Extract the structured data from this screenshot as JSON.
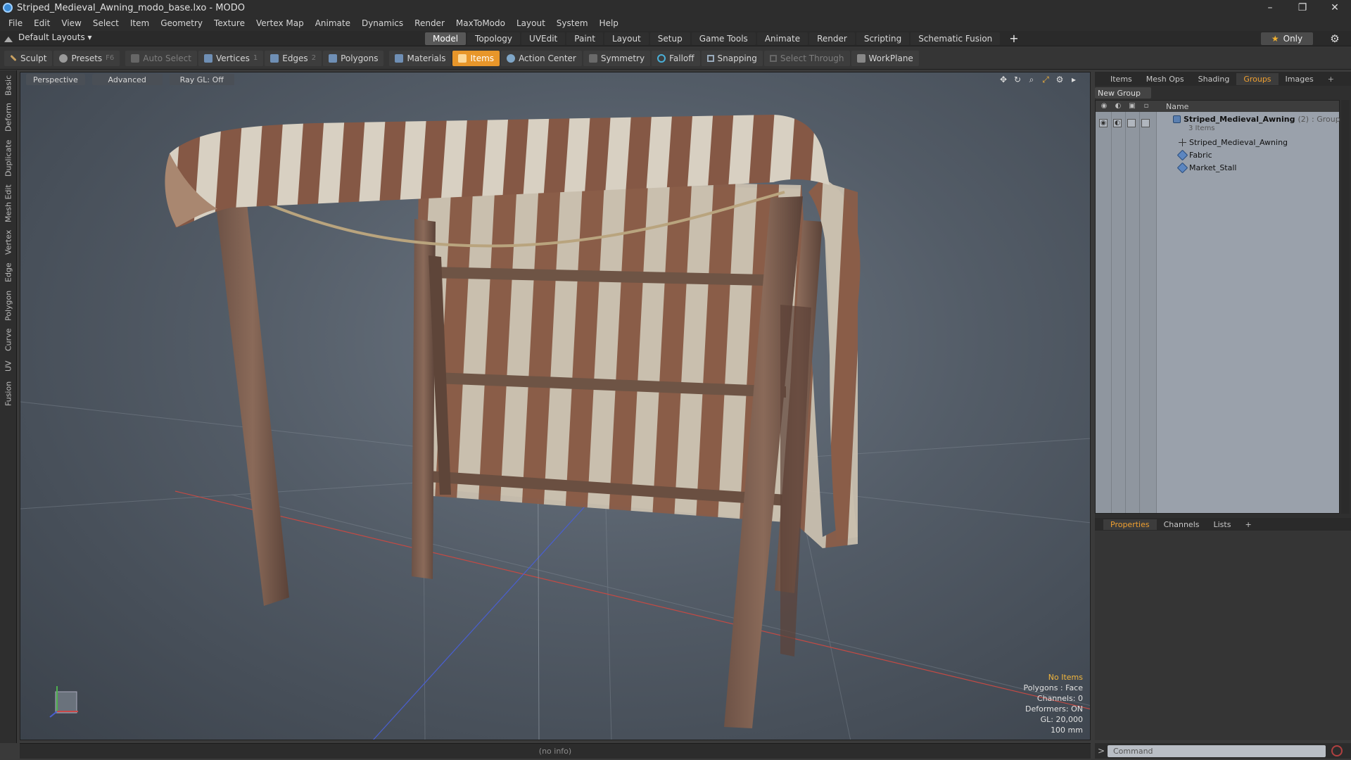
{
  "window": {
    "title": "Striped_Medieval_Awning_modo_base.lxo - MODO",
    "minimize": "–",
    "restore": "❐",
    "close": "✕"
  },
  "menu": [
    "File",
    "Edit",
    "View",
    "Select",
    "Item",
    "Geometry",
    "Texture",
    "Vertex Map",
    "Animate",
    "Dynamics",
    "Render",
    "MaxToModo",
    "Layout",
    "System",
    "Help"
  ],
  "layouts": {
    "label": "Default Layouts ▾"
  },
  "modes": [
    "Model",
    "Topology",
    "UVEdit",
    "Paint",
    "Layout",
    "Setup",
    "Game Tools",
    "Animate",
    "Render",
    "Scripting",
    "Schematic Fusion"
  ],
  "modes_active": "Model",
  "modes_plus": "+",
  "only": {
    "label": "Only",
    "star": "★"
  },
  "gear": "⚙",
  "toolbar": {
    "sculpt": "Sculpt",
    "presets": "Presets",
    "presets_key": "F6",
    "auto_select": "Auto Select",
    "vertices": "Vertices",
    "vertices_n": "1",
    "edges": "Edges",
    "edges_n": "2",
    "polygons": "Polygons",
    "materials": "Materials",
    "items": "Items",
    "action_center": "Action Center",
    "symmetry": "Symmetry",
    "falloff": "Falloff",
    "snapping": "Snapping",
    "select_through": "Select Through",
    "workplane": "WorkPlane"
  },
  "left_tabs": [
    "Basic",
    "Deform",
    "Duplicate",
    "Mesh Edit",
    "Vertex",
    "Edge",
    "Polygon",
    "Curve",
    "UV",
    "Fusion"
  ],
  "viewport": {
    "perspective": "Perspective",
    "advanced": "Advanced",
    "raygl": "Ray GL: Off",
    "info": [
      "No Items",
      "Polygons : Face",
      "Channels: 0",
      "Deformers: ON",
      "GL: 20,000",
      "100 mm"
    ]
  },
  "status": "(no info)",
  "right_tabs": [
    "Items",
    "Mesh Ops",
    "Shading",
    "Groups",
    "Images"
  ],
  "right_tab_active": "Groups",
  "right_plus": "+",
  "new_group": "New Group",
  "groups_header": {
    "name": "Name"
  },
  "groups": {
    "root": {
      "name": "Striped_Medieval_Awning",
      "count": "(2)",
      "type": ": Group",
      "sub": "3 Items"
    },
    "children": [
      "Striped_Medieval_Awning",
      "Fabric",
      "Market_Stall"
    ]
  },
  "props_tabs": [
    "Properties",
    "Channels",
    "Lists"
  ],
  "props_active": "Properties",
  "props_plus": "+",
  "command": {
    "prompt": ">",
    "placeholder": "Command"
  },
  "colors": {
    "accent": "#e8962a",
    "viewport": "#535c67"
  }
}
